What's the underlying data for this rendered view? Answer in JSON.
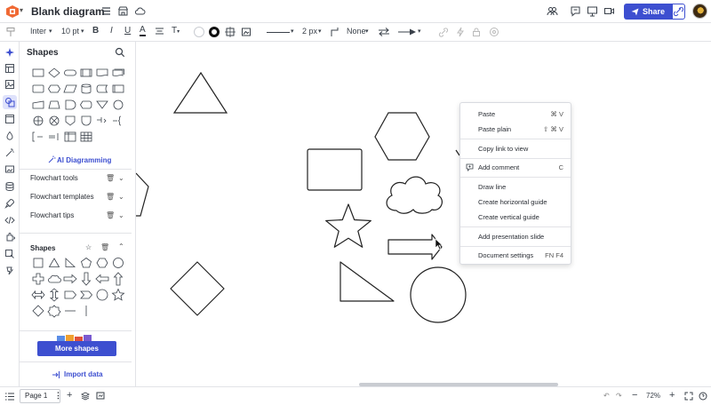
{
  "header": {
    "title": "Blank diagram",
    "share_label": "Share"
  },
  "toolbar": {
    "font": "Inter",
    "font_size": "10 pt",
    "bold": "B",
    "italic": "I",
    "underline": "U",
    "text_color": "A",
    "line_width": "2 px",
    "arrow_none": "None"
  },
  "panel": {
    "title": "Shapes",
    "ai_diagramming": "AI Diagramming",
    "libraries": [
      {
        "label": "Flowchart tools"
      },
      {
        "label": "Flowchart templates"
      },
      {
        "label": "Flowchart tips"
      }
    ],
    "shapes_section": "Shapes",
    "more_shapes": "More shapes",
    "import_data": "Import data"
  },
  "context_menu": {
    "items": [
      {
        "label": "Paste",
        "shortcut": "⌘ V"
      },
      {
        "label": "Paste plain",
        "shortcut": "⇧ ⌘ V"
      },
      {
        "label": "Copy link to view",
        "shortcut": ""
      },
      {
        "label": "Add comment",
        "shortcut": "C"
      },
      {
        "label": "Draw line",
        "shortcut": ""
      },
      {
        "label": "Create horizontal guide",
        "shortcut": ""
      },
      {
        "label": "Create vertical guide",
        "shortcut": ""
      },
      {
        "label": "Add presentation slide",
        "shortcut": ""
      },
      {
        "label": "Document settings",
        "shortcut": "FN F4"
      }
    ]
  },
  "footer": {
    "page_label": "Page 1",
    "zoom": "72%"
  },
  "colors": {
    "accent": "#3d4fd0",
    "logo": "#f06a35"
  }
}
